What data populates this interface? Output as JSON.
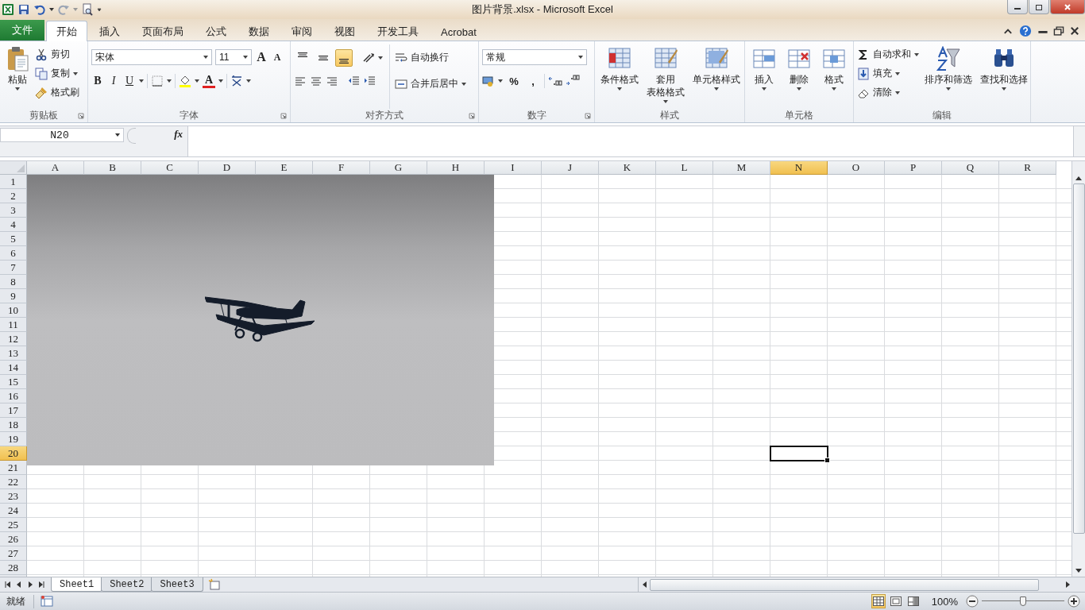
{
  "window": {
    "title": "图片背景.xlsx  -  Microsoft Excel"
  },
  "ribbon_tabs": [
    {
      "label": "文件",
      "kind": "file",
      "selected": false
    },
    {
      "label": "开始",
      "kind": "tab",
      "selected": true
    },
    {
      "label": "插入",
      "kind": "tab",
      "selected": false
    },
    {
      "label": "页面布局",
      "kind": "tab",
      "selected": false
    },
    {
      "label": "公式",
      "kind": "tab",
      "selected": false
    },
    {
      "label": "数据",
      "kind": "tab",
      "selected": false
    },
    {
      "label": "审阅",
      "kind": "tab",
      "selected": false
    },
    {
      "label": "视图",
      "kind": "tab",
      "selected": false
    },
    {
      "label": "开发工具",
      "kind": "tab",
      "selected": false
    },
    {
      "label": "Acrobat",
      "kind": "tab",
      "selected": false
    }
  ],
  "ribbon_groups": [
    {
      "kind": "clipboard",
      "label": "剪贴板",
      "dialog_launcher": true,
      "paste": "粘贴",
      "items": [
        "剪切",
        "复制",
        "格式刷"
      ]
    },
    {
      "kind": "font",
      "label": "字体",
      "dialog_launcher": true,
      "font_name": "宋体",
      "font_size": "11",
      "grow": "A",
      "shrink": "A",
      "bold": "B",
      "italic": "I",
      "underline": "U",
      "font_color": "A"
    },
    {
      "kind": "alignment",
      "label": "对齐方式",
      "dialog_launcher": true,
      "vertical_align": [
        {
          "selected": false
        },
        {
          "selected": false
        },
        {
          "selected": true
        }
      ],
      "wrap_text": "自动换行",
      "merge": "合并后居中"
    },
    {
      "kind": "number",
      "label": "数字",
      "dialog_launcher": true,
      "format": "常规",
      "percent": "%",
      "comma": ","
    },
    {
      "kind": "styles",
      "label": "样式",
      "dialog_launcher": false,
      "buttons": [
        {
          "lines": [
            "条件格式"
          ]
        },
        {
          "lines": [
            "套用",
            "表格格式"
          ]
        },
        {
          "lines": [
            "单元格样式"
          ]
        }
      ]
    },
    {
      "kind": "cells",
      "label": "单元格",
      "dialog_launcher": false,
      "buttons": [
        "插入",
        "删除",
        "格式"
      ]
    },
    {
      "kind": "editing",
      "label": "编辑",
      "dialog_launcher": false,
      "items": [
        "自动求和",
        "填充",
        "清除"
      ],
      "buttons": [
        "排序和筛选",
        "查找和选择"
      ]
    }
  ],
  "formula_bar": {
    "name_box": "N20",
    "function_label": "fx"
  },
  "sheet": {
    "columns": [
      {
        "label": "A",
        "selected": false
      },
      {
        "label": "B",
        "selected": false
      },
      {
        "label": "C",
        "selected": false
      },
      {
        "label": "D",
        "selected": false
      },
      {
        "label": "E",
        "selected": false
      },
      {
        "label": "F",
        "selected": false
      },
      {
        "label": "G",
        "selected": false
      },
      {
        "label": "H",
        "selected": false
      },
      {
        "label": "I",
        "selected": false
      },
      {
        "label": "J",
        "selected": false
      },
      {
        "label": "K",
        "selected": false
      },
      {
        "label": "L",
        "selected": false
      },
      {
        "label": "M",
        "selected": false
      },
      {
        "label": "N",
        "selected": true
      },
      {
        "label": "O",
        "selected": false
      },
      {
        "label": "P",
        "selected": false
      },
      {
        "label": "Q",
        "selected": false
      },
      {
        "label": "R",
        "selected": false
      }
    ],
    "rows": [
      {
        "label": "1",
        "selected": false
      },
      {
        "label": "2",
        "selected": false
      },
      {
        "label": "3",
        "selected": false
      },
      {
        "label": "4",
        "selected": false
      },
      {
        "label": "5",
        "selected": false
      },
      {
        "label": "6",
        "selected": false
      },
      {
        "label": "7",
        "selected": false
      },
      {
        "label": "8",
        "selected": false
      },
      {
        "label": "9",
        "selected": false
      },
      {
        "label": "10",
        "selected": false
      },
      {
        "label": "11",
        "selected": false
      },
      {
        "label": "12",
        "selected": false
      },
      {
        "label": "13",
        "selected": false
      },
      {
        "label": "14",
        "selected": false
      },
      {
        "label": "15",
        "selected": false
      },
      {
        "label": "16",
        "selected": false
      },
      {
        "label": "17",
        "selected": false
      },
      {
        "label": "18",
        "selected": false
      },
      {
        "label": "19",
        "selected": false
      },
      {
        "label": "20",
        "selected": true
      },
      {
        "label": "21",
        "selected": false
      },
      {
        "label": "22",
        "selected": false
      },
      {
        "label": "23",
        "selected": false
      },
      {
        "label": "24",
        "selected": false
      },
      {
        "label": "25",
        "selected": false
      },
      {
        "label": "26",
        "selected": false
      },
      {
        "label": "27",
        "selected": false
      },
      {
        "label": "28",
        "selected": false
      }
    ]
  },
  "sheet_tabs": [
    {
      "label": "Sheet1",
      "selected": true
    },
    {
      "label": "Sheet2",
      "selected": false
    },
    {
      "label": "Sheet3",
      "selected": false
    }
  ],
  "status_bar": {
    "status": "就绪",
    "view_modes": [
      {
        "kind": "normal",
        "selected": true
      },
      {
        "kind": "page_layout",
        "selected": false
      },
      {
        "kind": "page_break",
        "selected": false
      }
    ],
    "zoom": "100%",
    "zoom_slider": {
      "level": 0.5
    }
  }
}
